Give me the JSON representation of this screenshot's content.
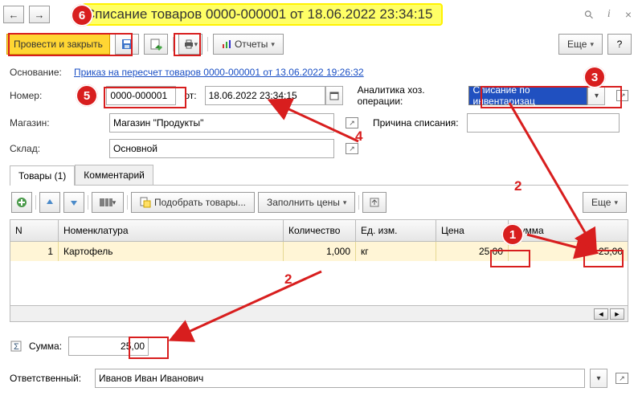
{
  "title": "Списание товаров 0000-000001 от 18.06.2022 23:34:15",
  "toolbar": {
    "post_close": "Провести и закрыть",
    "reports": "Отчеты",
    "more": "Еще",
    "q": "?"
  },
  "basis": {
    "label": "Основание:",
    "link": "Приказ на пересчет товаров 0000-000001 от 13.06.2022 19:26:32"
  },
  "fields": {
    "number_label": "Номер:",
    "number": "0000-000001",
    "from": "от:",
    "date": "18.06.2022 23:34:15",
    "analytic_label": "Аналитика хоз. операции:",
    "analytic": "Списание по инвентаризац",
    "shop_label": "Магазин:",
    "shop": "Магазин \"Продукты\"",
    "reason_label": "Причина списания:",
    "reason": "",
    "warehouse_label": "Склад:",
    "warehouse": "Основной"
  },
  "tabs": {
    "goods": "Товары (1)",
    "comment": "Комментарий"
  },
  "grid_toolbar": {
    "pick": "Подобрать товары...",
    "fill": "Заполнить цены",
    "more": "Еще"
  },
  "grid": {
    "cols": {
      "n": "N",
      "nomen": "Номенклатура",
      "qty": "Количество",
      "unit": "Ед. изм.",
      "price": "Цена",
      "sum": "Сумма"
    },
    "rows": [
      {
        "n": "1",
        "nomen": "Картофель",
        "qty": "1,000",
        "unit": "кг",
        "price": "25,00",
        "sum": "25,00"
      }
    ]
  },
  "footer": {
    "sum_label": "Сумма:",
    "sum": "25,00",
    "resp_label": "Ответственный:",
    "resp": "Иванов Иван Иванович"
  },
  "ann": {
    "n1": "1",
    "n2": "2",
    "n3": "3",
    "n4": "4",
    "n5": "5",
    "n6": "6"
  }
}
